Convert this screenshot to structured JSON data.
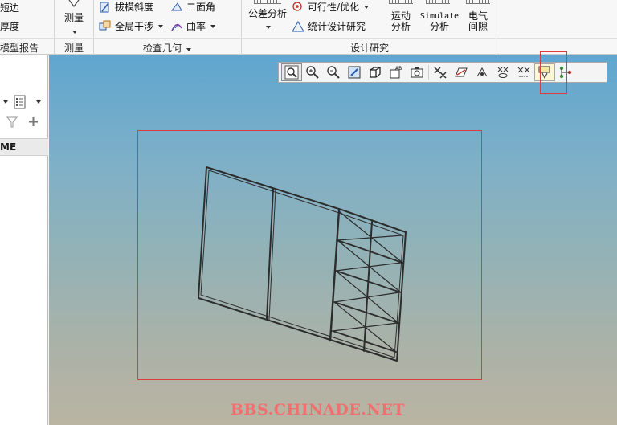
{
  "ribbon": {
    "col1": {
      "item1": "短边",
      "item2": "厚度",
      "group_label": "模型报告"
    },
    "measure": {
      "label": "测量",
      "group_label": "测量"
    },
    "inspect_geometry": {
      "draft_check": "拔模斜度",
      "dihedral": "二面角",
      "global_interference": "全局干涉",
      "curvature": "曲率",
      "group_label": "检查几何"
    },
    "design_study": {
      "tolerance_analysis": "公差分析",
      "feasibility": "可行性/优化",
      "statistical_study": "统计设计研究",
      "motion_1": "运动",
      "motion_2": "分析",
      "simulate_1": "Simulate",
      "simulate_2": "分析",
      "electrical_1": "电气",
      "electrical_2": "间隙",
      "group_label": "设计研究"
    }
  },
  "left_panel": {
    "column_header": "ME"
  },
  "watermark": "BBS.CHINADE.NET",
  "graphics_toolbar": {
    "buttons": [
      "zoom-fit",
      "zoom-in",
      "zoom-out",
      "repaint",
      "display-style",
      "saved-views",
      "view-manager",
      "datum-display",
      "annotation-display",
      "spin-center",
      "point-display",
      "csys-display",
      "model-display-filter",
      "connection-display"
    ]
  },
  "colors": {
    "highlight": "#e03a3a",
    "watermark": "#f07070",
    "viewport_top": "#5fa6cf",
    "viewport_bottom": "#bab4a2"
  }
}
